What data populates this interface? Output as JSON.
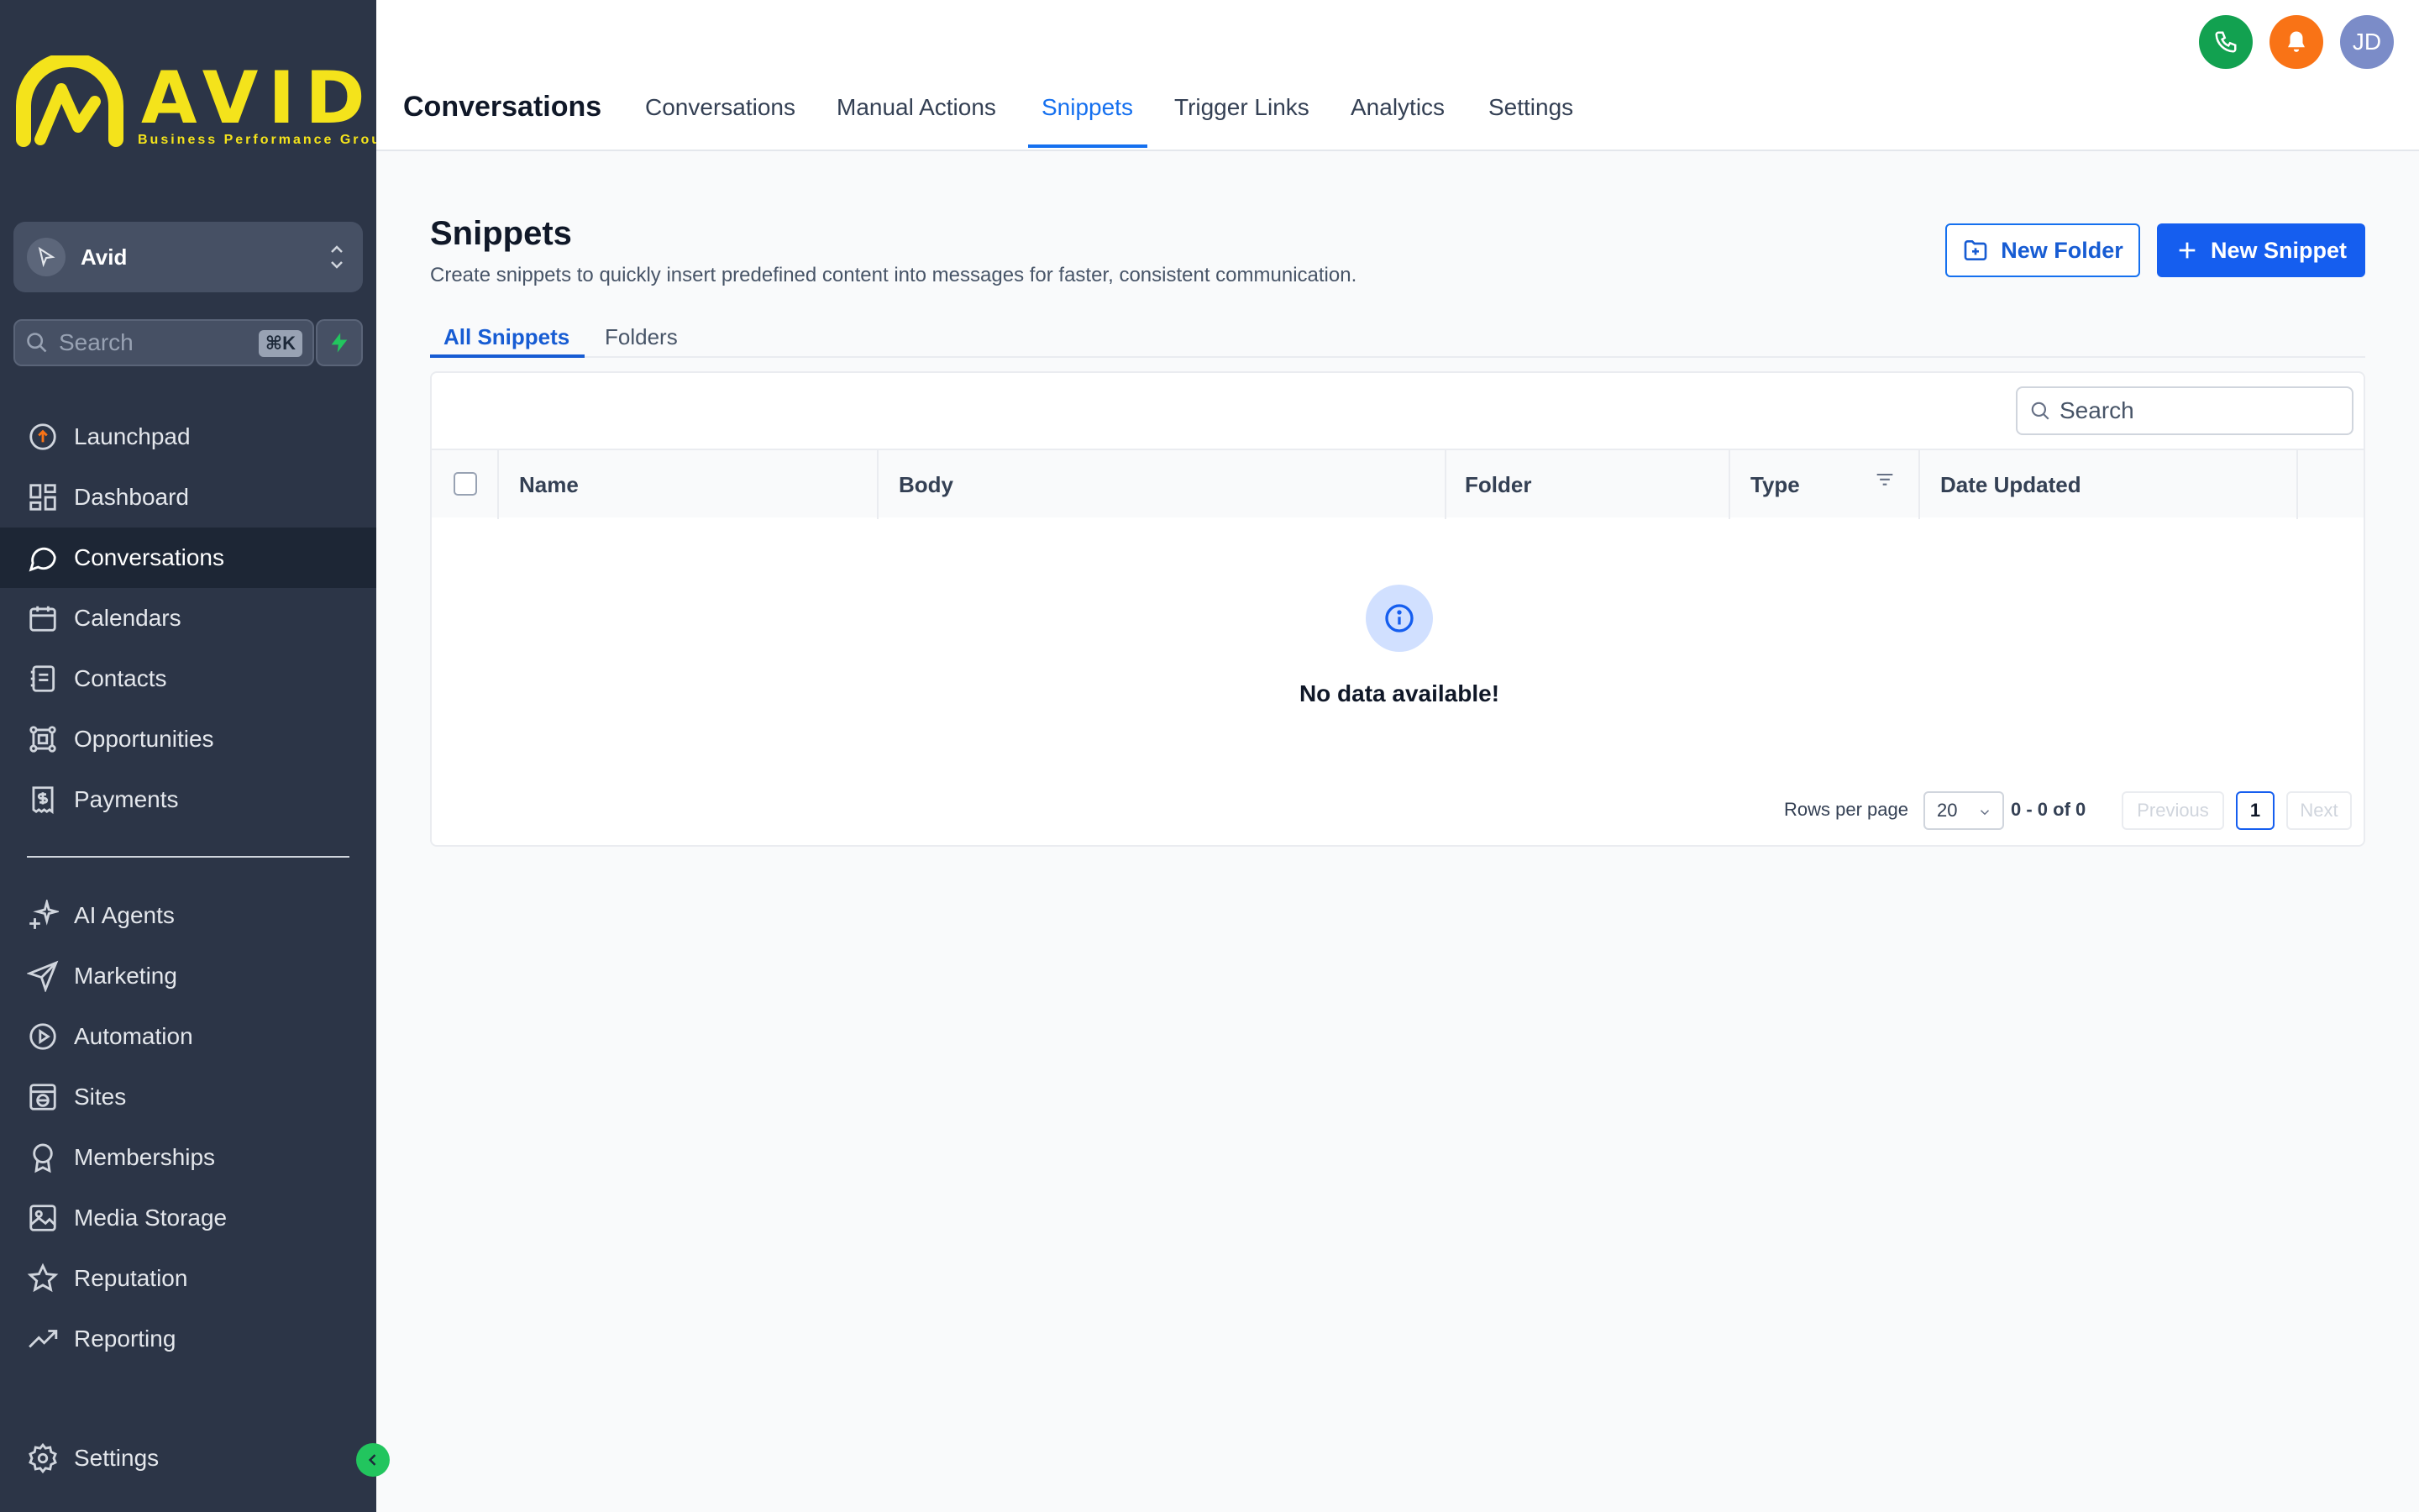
{
  "brand": {
    "logo_text": "AVID",
    "logo_subtitle": "Business Performance Group",
    "logo_color": "#f4e31b"
  },
  "sidebar": {
    "account_name": "Avid",
    "search_placeholder": "Search",
    "search_shortcut": "⌘K",
    "nav_items": [
      {
        "label": "Launchpad",
        "icon": "launchpad-icon"
      },
      {
        "label": "Dashboard",
        "icon": "dashboard-icon"
      },
      {
        "label": "Conversations",
        "icon": "chat-bubble-icon",
        "active": true
      },
      {
        "label": "Calendars",
        "icon": "calendar-icon"
      },
      {
        "label": "Contacts",
        "icon": "contacts-icon"
      },
      {
        "label": "Opportunities",
        "icon": "opportunities-icon"
      },
      {
        "label": "Payments",
        "icon": "payments-icon"
      }
    ],
    "nav_items_2": [
      {
        "label": "AI Agents",
        "icon": "sparkle-icon"
      },
      {
        "label": "Marketing",
        "icon": "send-icon"
      },
      {
        "label": "Automation",
        "icon": "automation-icon"
      },
      {
        "label": "Sites",
        "icon": "globe-window-icon"
      },
      {
        "label": "Memberships",
        "icon": "award-icon"
      },
      {
        "label": "Media Storage",
        "icon": "image-icon"
      },
      {
        "label": "Reputation",
        "icon": "star-icon"
      },
      {
        "label": "Reporting",
        "icon": "trend-up-icon"
      }
    ],
    "settings_label": "Settings"
  },
  "header": {
    "title": "Conversations",
    "tabs": [
      {
        "label": "Conversations"
      },
      {
        "label": "Manual Actions"
      },
      {
        "label": "Snippets",
        "active": true
      },
      {
        "label": "Trigger Links"
      },
      {
        "label": "Analytics"
      },
      {
        "label": "Settings"
      }
    ],
    "user_initials": "JD",
    "colors": {
      "phone": "#12a150",
      "bell": "#f97316",
      "avatar": "#7b8cc8",
      "accent": "#1570ef"
    }
  },
  "main": {
    "title": "Snippets",
    "description": "Create snippets to quickly insert predefined content into messages for faster, consistent communication.",
    "new_folder_label": "New Folder",
    "new_snippet_label": "New Snippet",
    "sub_tabs": [
      {
        "label": "All Snippets",
        "active": true
      },
      {
        "label": "Folders"
      }
    ],
    "table": {
      "search_placeholder": "Search",
      "columns": [
        "Name",
        "Body",
        "Folder",
        "Type",
        "Date Updated"
      ],
      "empty_message": "No data available!",
      "rows_per_page_label": "Rows per page",
      "rows_per_page": "20",
      "range": "0 - 0 of 0",
      "previous_label": "Previous",
      "next_label": "Next",
      "current_page": "1"
    }
  }
}
